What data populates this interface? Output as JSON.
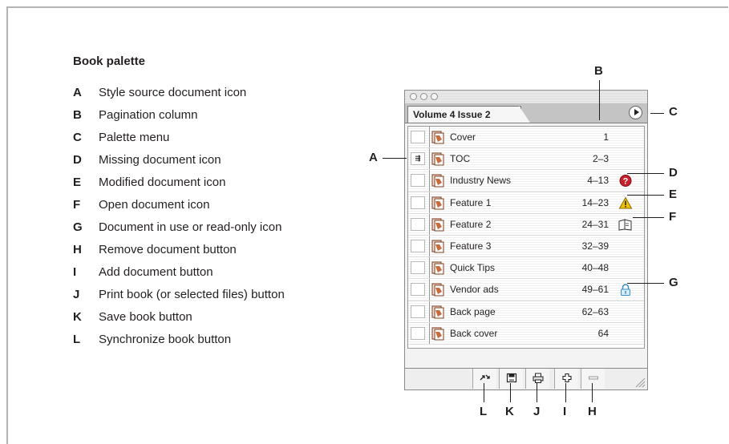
{
  "legend": {
    "title": "Book palette",
    "items": [
      {
        "letter": "A",
        "text": "Style source document icon"
      },
      {
        "letter": "B",
        "text": "Pagination column"
      },
      {
        "letter": "C",
        "text": "Palette menu"
      },
      {
        "letter": "D",
        "text": "Missing document icon"
      },
      {
        "letter": "E",
        "text": "Modified document icon"
      },
      {
        "letter": "F",
        "text": "Open document icon"
      },
      {
        "letter": "G",
        "text": "Document in use or read-only icon"
      },
      {
        "letter": "H",
        "text": "Remove document button"
      },
      {
        "letter": "I",
        "text": "Add document button"
      },
      {
        "letter": "J",
        "text": "Print book (or selected files) button"
      },
      {
        "letter": "K",
        "text": "Save book button"
      },
      {
        "letter": "L",
        "text": "Synchronize book button"
      }
    ]
  },
  "palette": {
    "tab_title": "Volume 4 Issue 2",
    "style_source_glyph": "⇶",
    "documents": [
      {
        "name": "Cover",
        "pages": "1",
        "status": ""
      },
      {
        "name": "TOC",
        "pages": "2–3",
        "status": ""
      },
      {
        "name": "Industry News",
        "pages": "4–13",
        "status": "missing-icon"
      },
      {
        "name": "Feature 1",
        "pages": "14–23",
        "status": "modified-icon"
      },
      {
        "name": "Feature 2",
        "pages": "24–31",
        "status": "open-book-icon"
      },
      {
        "name": "Feature 3",
        "pages": "32–39",
        "status": ""
      },
      {
        "name": "Quick Tips",
        "pages": "40–48",
        "status": ""
      },
      {
        "name": "Vendor ads",
        "pages": "49–61",
        "status": "lock-icon"
      },
      {
        "name": "Back page",
        "pages": "62–63",
        "status": ""
      },
      {
        "name": "Back cover",
        "pages": "64",
        "status": ""
      }
    ],
    "buttons": [
      "synchronize-icon",
      "save-icon",
      "print-icon",
      "add-icon",
      "remove-icon"
    ]
  },
  "callouts": {
    "a": "A",
    "b": "B",
    "c": "C",
    "d": "D",
    "e": "E",
    "f": "F",
    "g": "G",
    "h": "H",
    "i": "I",
    "j": "J",
    "k": "K",
    "l": "L"
  },
  "colors": {
    "missing": "#c8202a",
    "modified": "#f2c200",
    "lock": "#3a8fc4",
    "doc_icon": "#c96a3c"
  }
}
